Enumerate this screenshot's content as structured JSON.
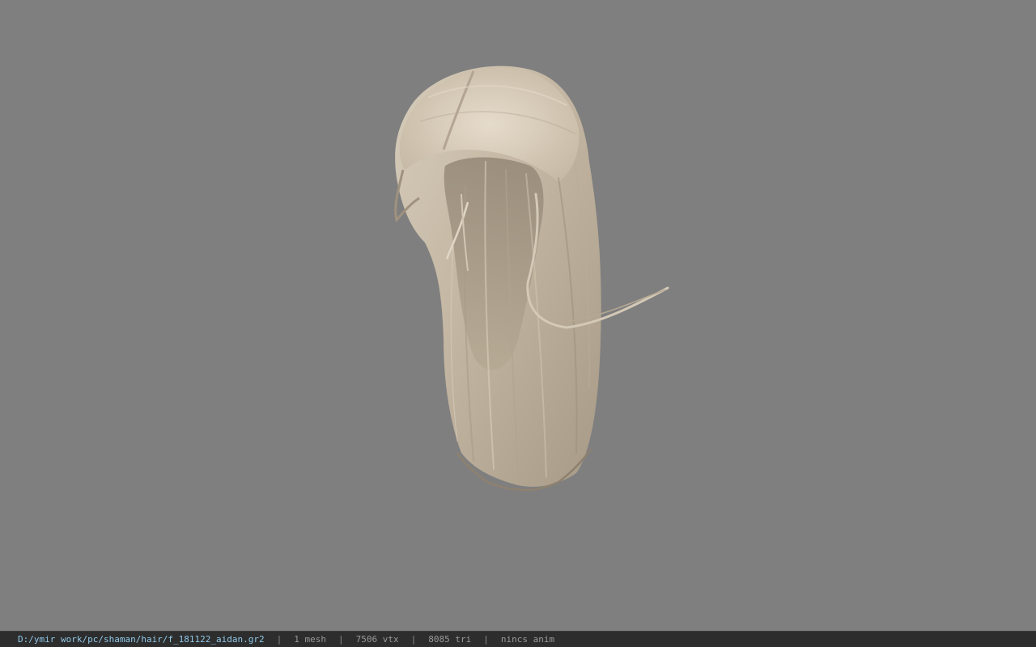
{
  "viewer": {
    "background_color": "#7f7f7f",
    "model": {
      "subject": "hair mesh",
      "base_color": "#c3b6a2"
    }
  },
  "status_bar": {
    "file_path": "D:/ymir work/pc/shaman/hair/f_181122_aidan.gr2",
    "separator": "|",
    "mesh_count": "1 mesh",
    "vertex_count": "7506 vtx",
    "triangle_count": "8085 tri",
    "animation": "nincs anim",
    "path_color": "#8fc8e8",
    "text_color": "#9a9a9a",
    "background_color": "#2d2d2d"
  }
}
